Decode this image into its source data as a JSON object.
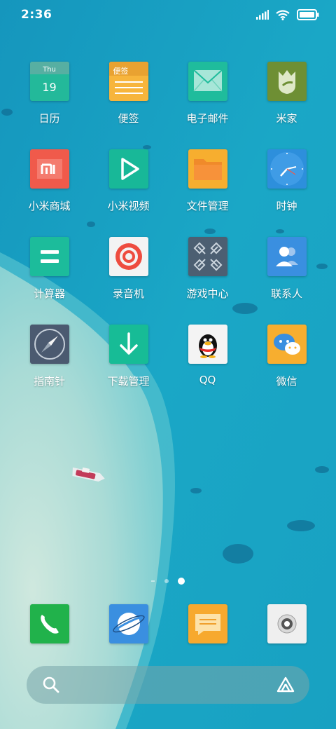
{
  "status_bar": {
    "time": "2:36"
  },
  "apps": [
    [
      {
        "name": "calendar",
        "label": "日历",
        "icon": "calendar-icon",
        "color": "#23b99a",
        "day": "Thu",
        "date": "19"
      },
      {
        "name": "notes",
        "label": "便签",
        "icon": "notes-icon",
        "color": "#f7b53c",
        "title": "便签"
      },
      {
        "name": "email",
        "label": "电子邮件",
        "icon": "envelope-icon",
        "color": "#1fbc9c"
      },
      {
        "name": "mijia",
        "label": "米家",
        "icon": "mijia-icon",
        "color": "#6e8f34"
      }
    ],
    [
      {
        "name": "mi-store",
        "label": "小米商城",
        "icon": "mi-logo-icon",
        "color": "#f05a4b"
      },
      {
        "name": "mi-video",
        "label": "小米视频",
        "icon": "play-icon",
        "color": "#18b898"
      },
      {
        "name": "file-manager",
        "label": "文件管理",
        "icon": "folder-icon",
        "color": "#f7ae2f"
      },
      {
        "name": "clock",
        "label": "时钟",
        "icon": "clock-icon",
        "color": "#2d8fdc"
      }
    ],
    [
      {
        "name": "calculator",
        "label": "计算器",
        "icon": "equals-icon",
        "color": "#1cbc9b"
      },
      {
        "name": "recorder",
        "label": "录音机",
        "icon": "record-icon",
        "color": "#f3f3f3"
      },
      {
        "name": "game-center",
        "label": "游戏中心",
        "icon": "gamepad-icon",
        "color": "#4c5f72"
      },
      {
        "name": "contacts",
        "label": "联系人",
        "icon": "contacts-icon",
        "color": "#3a8fe0"
      }
    ],
    [
      {
        "name": "compass",
        "label": "指南针",
        "icon": "compass-icon",
        "color": "#4b5a70"
      },
      {
        "name": "downloads",
        "label": "下载管理",
        "icon": "download-arrow-icon",
        "color": "#17bc96"
      },
      {
        "name": "qq",
        "label": "QQ",
        "icon": "qq-penguin-icon",
        "color": "#f4f4f4"
      },
      {
        "name": "wechat",
        "label": "微信",
        "icon": "chat-bubbles-icon",
        "color": "#f7ae2f"
      }
    ]
  ],
  "dock": [
    {
      "name": "phone",
      "icon": "phone-icon",
      "color": "#21b24b"
    },
    {
      "name": "browser",
      "icon": "planet-icon",
      "color": "#3a8fe0"
    },
    {
      "name": "messages",
      "icon": "message-icon",
      "color": "#f7a92e"
    },
    {
      "name": "camera",
      "icon": "camera-lens-icon",
      "color": "#efefef"
    }
  ],
  "page_indicator": {
    "pages": 3,
    "active": 3
  },
  "search": {
    "icon": "search-icon",
    "assistant_icon": "assistant-icon"
  }
}
